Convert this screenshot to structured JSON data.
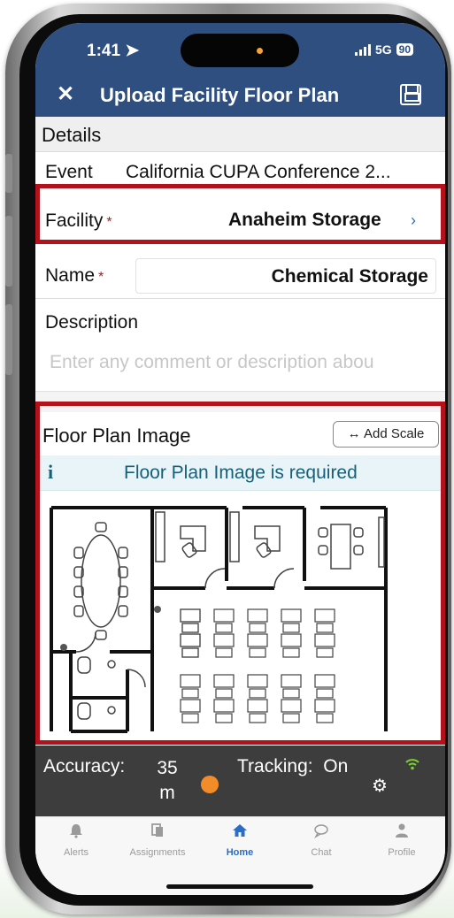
{
  "status": {
    "time": "1:41",
    "network": "5G",
    "battery": "90"
  },
  "header": {
    "title": "Upload Facility Floor Plan",
    "close_icon": "close-icon",
    "save_icon": "save-icon"
  },
  "details": {
    "section_title": "Details",
    "event_label": "Event",
    "event_value": "California CUPA Conference 2...",
    "facility_label": "Facility",
    "facility_value": "Anaheim Storage",
    "required_mark": "*",
    "name_label": "Name",
    "name_value": "Chemical Storage",
    "description_label": "Description",
    "description_placeholder": "Enter any comment or description abou"
  },
  "floor_plan": {
    "section_title": "Floor Plan Image",
    "add_scale_label": "Add Scale",
    "info_text": "Floor Plan Image is required"
  },
  "tracking": {
    "accuracy_label": "Accuracy:",
    "accuracy_value": "35",
    "accuracy_unit": "m",
    "tracking_label": "Tracking:",
    "tracking_value": "On",
    "status_color": "#f28c28"
  },
  "tabs": [
    {
      "label": "Alerts",
      "icon": "bell-icon"
    },
    {
      "label": "Assignments",
      "icon": "assignments-icon"
    },
    {
      "label": "Home",
      "icon": "home-icon",
      "active": true
    },
    {
      "label": "Chat",
      "icon": "chat-icon"
    },
    {
      "label": "Profile",
      "icon": "profile-icon"
    }
  ],
  "colors": {
    "header": "#2f4f80",
    "highlight": "#b3111b",
    "info": "#17607a",
    "active_tab": "#2b6cc4"
  }
}
